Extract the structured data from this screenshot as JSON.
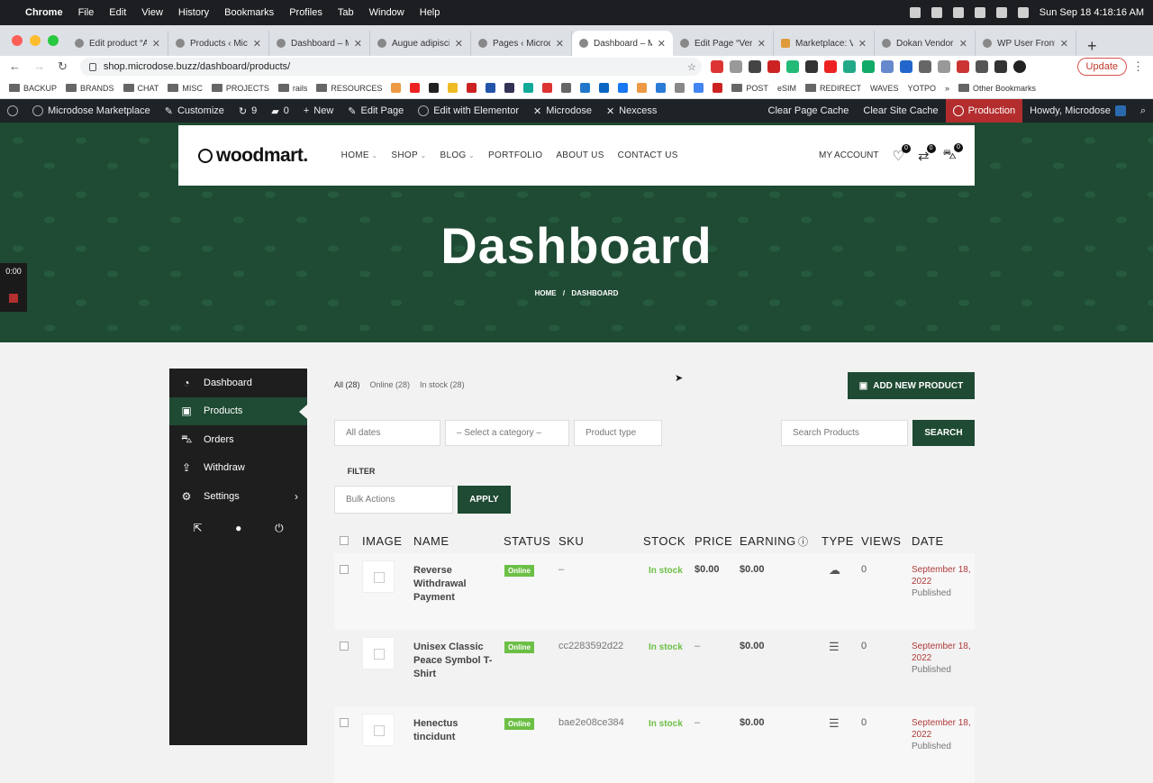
{
  "macbar": {
    "app": "Chrome",
    "menus": [
      "File",
      "Edit",
      "View",
      "History",
      "Bookmarks",
      "Profiles",
      "Tab",
      "Window",
      "Help"
    ],
    "datetime": "Sun Sep 18  4:18:16 AM"
  },
  "tabs": [
    {
      "label": "Edit product “A"
    },
    {
      "label": "Products ‹ Micr"
    },
    {
      "label": "Dashboard – M"
    },
    {
      "label": "Augue adipiscir"
    },
    {
      "label": "Pages ‹ Microd"
    },
    {
      "label": "Dashboard – M"
    },
    {
      "label": "Edit Page “Vend"
    },
    {
      "label": "Marketplace: V"
    },
    {
      "label": "Dokan Vendor D"
    },
    {
      "label": "WP User Fronte"
    }
  ],
  "address": {
    "url": "shop.microdose.buzz/dashboard/products/",
    "update_label": "Update"
  },
  "bookmarks": {
    "folders": [
      "BACKUP",
      "BRANDS",
      "CHAT",
      "MISC",
      "PROJECTS",
      "rails",
      "RESOURCES"
    ],
    "links": [
      "POST",
      "eSIM",
      "REDIRECT",
      "WAVES",
      "YOTPO"
    ],
    "more": "»",
    "other": "Other Bookmarks"
  },
  "adminbar": {
    "site": "Microdose Marketplace",
    "customize": "Customize",
    "updates": "9",
    "comments": "0",
    "new": "New",
    "edit_page": "Edit Page",
    "elementor": "Edit with Elementor",
    "microdose": "Microdose",
    "nexcess": "Nexcess",
    "clear_page": "Clear Page Cache",
    "clear_site": "Clear Site Cache",
    "production": "Production",
    "howdy": "Howdy, Microdose"
  },
  "site": {
    "logo": "woodmart.",
    "menu": [
      "HOME",
      "SHOP",
      "BLOG",
      "PORTFOLIO",
      "ABOUT US",
      "CONTACT US"
    ],
    "account": "MY ACCOUNT",
    "wishlist_count": "0",
    "compare_count": "0",
    "cart_count": "0"
  },
  "hero": {
    "title": "Dashboard",
    "crumb_home": "HOME",
    "crumb_sep": "/",
    "crumb_current": "DASHBOARD"
  },
  "recorder": {
    "time": "0:00"
  },
  "sidebar": {
    "items": [
      {
        "label": "Dashboard"
      },
      {
        "label": "Products"
      },
      {
        "label": "Orders"
      },
      {
        "label": "Withdraw"
      },
      {
        "label": "Settings"
      }
    ]
  },
  "products": {
    "filters": {
      "all": "All (28)",
      "online": "Online (28)",
      "instock": "In stock (28)"
    },
    "add_new": "ADD NEW PRODUCT",
    "dates": "All dates",
    "category": "– Select a category –",
    "type": "Product type",
    "search_placeholder": "Search Products",
    "search": "SEARCH",
    "filter": "FILTER",
    "bulk": "Bulk Actions",
    "apply": "APPLY",
    "columns": [
      "IMAGE",
      "NAME",
      "STATUS",
      "SKU",
      "STOCK",
      "PRICE",
      "EARNING",
      "TYPE",
      "VIEWS",
      "DATE"
    ],
    "rows": [
      {
        "name": "Reverse Withdrawal Payment",
        "status": "Online",
        "sku": "–",
        "stock": "In stock",
        "price": "$0.00",
        "earning": "$0.00",
        "type": "☁",
        "views": "0",
        "date": "September 18, 2022",
        "state": "Published"
      },
      {
        "name": "Unisex Classic Peace Symbol T-Shirt",
        "status": "Online",
        "sku": "cc2283592d22",
        "stock": "In stock",
        "price": "–",
        "earning": "$0.00",
        "type": "☰",
        "views": "0",
        "date": "September 18, 2022",
        "state": "Published"
      },
      {
        "name": "Henectus tincidunt",
        "status": "Online",
        "sku": "bae2e08ce384",
        "stock": "In stock",
        "price": "–",
        "earning": "$0.00",
        "type": "☰",
        "views": "0",
        "date": "September 18, 2022",
        "state": "Published"
      }
    ]
  }
}
